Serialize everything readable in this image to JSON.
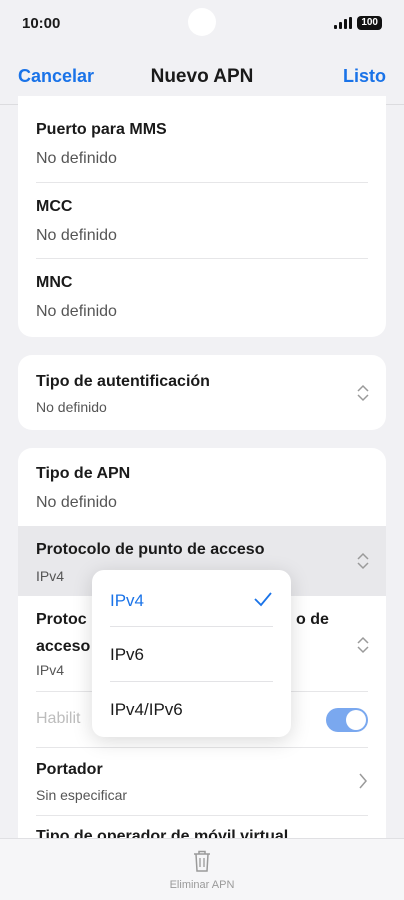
{
  "status_bar": {
    "time": "10:00",
    "battery": "100"
  },
  "nav": {
    "cancel": "Cancelar",
    "title": "Nuevo APN",
    "done": "Listo"
  },
  "card1": {
    "items": [
      {
        "title": "Puerto para MMS",
        "value": "No definido"
      },
      {
        "title": "MCC",
        "value": "No definido"
      },
      {
        "title": "MNC",
        "value": "No definido"
      }
    ]
  },
  "card2": {
    "title": "Tipo de autentificación",
    "value": "No definido"
  },
  "card3": {
    "apn_type": {
      "title": "Tipo de APN",
      "value": "No definido"
    },
    "protocol": {
      "title": "Protocolo de punto de acceso",
      "value": "IPv4"
    },
    "roaming_protocol": {
      "title_left_1": "Protoc",
      "title_right": "o de",
      "title_left_2": "acceso",
      "value": "IPv4"
    },
    "enable": {
      "title": "Habilit",
      "toggle_on": true
    },
    "bearer": {
      "title": "Portador",
      "value": "Sin especificar"
    },
    "mvno": {
      "title": "Tipo de operador de móvil virtual"
    }
  },
  "popup": {
    "options": [
      "IPv4",
      "IPv6",
      "IPv4/IPv6"
    ],
    "selected_index": 0
  },
  "bottom": {
    "delete_label": "Eliminar APN"
  },
  "colors": {
    "accent": "#1a73e8",
    "background": "#f1f1f4",
    "toggle": "#7aa8ef"
  }
}
